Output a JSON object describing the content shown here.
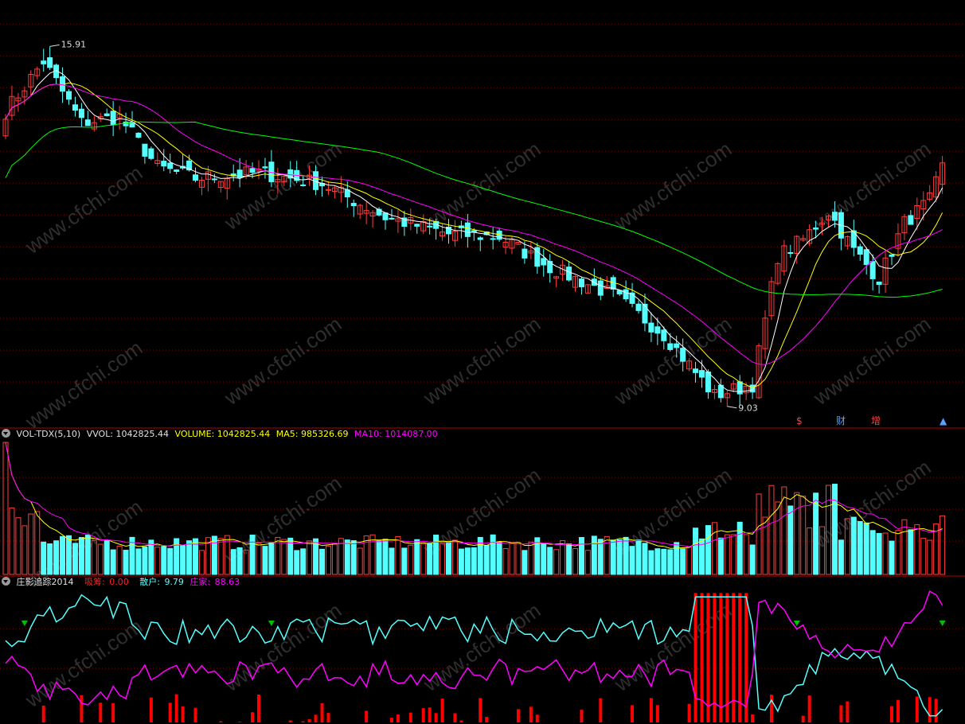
{
  "price_panel": {
    "high_label": "15.91",
    "low_label": "9.03",
    "markers": [
      {
        "text": "$",
        "color": "#ff4040"
      },
      {
        "text": "财",
        "color": "#5aa0ff"
      },
      {
        "text": "增",
        "color": "#ff4040"
      },
      {
        "text": "▲",
        "color": "#5aa0ff"
      }
    ]
  },
  "volume_panel": {
    "indicator": "VOL-TDX(5,10)",
    "vvol": "VVOL: 1042825.44",
    "volume": "VOLUME: 1042825.44",
    "ma5": "MA5: 985326.69",
    "ma10": "MA10: 1014087.00"
  },
  "zy_panel": {
    "indicator": "庄影追踪2014",
    "xichou_label": "吸筹:",
    "xichou_value": "0.00",
    "sanhu_label": "散户:",
    "sanhu_value": "9.79",
    "zhuangjia_label": "庄家:",
    "zhuangjia_value": "88.63"
  },
  "watermark": "www.cfchi.com",
  "colors": {
    "up": "#ff3c3c",
    "down": "#54ffff",
    "ma5": "#ffffff",
    "ma10": "#ffff00",
    "ma20": "#ff00ff",
    "ma60": "#00ff00",
    "grid": "#8a0000",
    "separator": "#b00000",
    "xichou": "#ff0000",
    "sanhu": "#54ffff",
    "zhuangjia": "#ff00ff",
    "signal": "#00c000"
  },
  "chart_data": [
    {
      "type": "candlestick",
      "title": "",
      "ylim": [
        8.6,
        16.2
      ],
      "annotations": [
        "15.91",
        "9.03"
      ],
      "anchors": [
        {
          "i": 0,
          "c": 14.2
        },
        {
          "i": 6,
          "c": 15.1
        },
        {
          "i": 12,
          "c": 14.0
        },
        {
          "i": 18,
          "c": 14.1
        },
        {
          "i": 24,
          "c": 13.2
        },
        {
          "i": 30,
          "c": 13.0
        },
        {
          "i": 40,
          "c": 13.1
        },
        {
          "i": 50,
          "c": 12.9
        },
        {
          "i": 60,
          "c": 12.3
        },
        {
          "i": 70,
          "c": 12.0
        },
        {
          "i": 78,
          "c": 11.95
        },
        {
          "i": 86,
          "c": 11.4
        },
        {
          "i": 96,
          "c": 10.9
        },
        {
          "i": 104,
          "c": 10.2
        },
        {
          "i": 112,
          "c": 9.1
        },
        {
          "i": 118,
          "c": 9.3
        },
        {
          "i": 122,
          "c": 11.6
        },
        {
          "i": 126,
          "c": 11.9
        },
        {
          "i": 130,
          "c": 12.4
        },
        {
          "i": 134,
          "c": 11.7
        },
        {
          "i": 138,
          "c": 11.2
        },
        {
          "i": 142,
          "c": 12.2
        },
        {
          "i": 146,
          "c": 12.6
        },
        {
          "i": 148,
          "c": 13.2
        }
      ],
      "count": 149,
      "ma_periods": [
        5,
        10,
        20,
        60
      ]
    },
    {
      "type": "bar",
      "title": "VOL-TDX(5,10)",
      "series": [
        {
          "name": "VOLUME"
        },
        {
          "name": "MA5"
        },
        {
          "name": "MA10"
        }
      ],
      "last": {
        "volume": 1042825.44,
        "ma5": 985326.69,
        "ma10": 1014087.0
      }
    },
    {
      "type": "line",
      "title": "庄影追踪2014",
      "ylim": [
        0,
        100
      ],
      "series": [
        {
          "name": "散户",
          "last": 9.79
        },
        {
          "name": "庄家",
          "last": 88.63
        },
        {
          "name": "吸筹",
          "last": 0.0
        }
      ]
    }
  ]
}
